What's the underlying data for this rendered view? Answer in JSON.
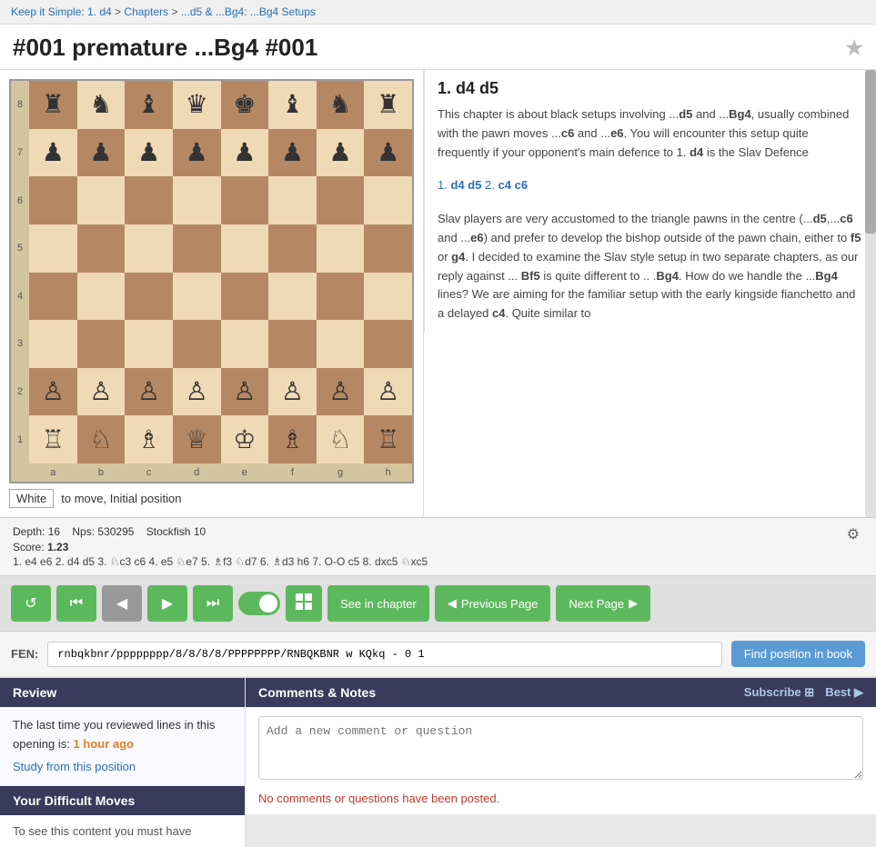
{
  "breadcrumb": {
    "items": [
      {
        "label": "Keep it Simple: 1. d4",
        "href": "#"
      },
      {
        "label": "Chapters",
        "href": "#"
      },
      {
        "label": "...d5 & ...Bg4: ...Bg4 Setups",
        "href": "#"
      }
    ],
    "separator": " > "
  },
  "page": {
    "title": "#001 premature ...Bg4 #001"
  },
  "board": {
    "status_side": "White",
    "status_text": "to move, Initial position",
    "fen_value": "rnbqkbnr/pppppppp/8/8/8/8/PPPPPPPP/RNBQKBNR w KQkq - 0 1",
    "fen_label": "FEN:"
  },
  "text_panel": {
    "move_header": "1. d4  d5",
    "paragraphs": [
      "This chapter is about black setups involving ...d5 and ...Bg4, usually combined with the pawn moves ...c6 and ...e6. You will encounter this setup quite frequently if your opponent's main defence to 1. d4 is the Slav Defence",
      "1. d4 d5 2. c4 c6",
      "Slav players are very accustomed to the triangle pawns in the centre (...d5,...c6 and ...e6) and prefer to develop the bishop outside of the pawn chain, either to f5 or g4. I decided to examine the Slav style setup in two separate chapters, as our reply against ... Bf5 is quite different to .. .Bg4. How do we handle the ...Bg4 lines? We are aiming for the familiar setup with the early kingside fianchetto and a delayed c4. Quite similar to"
    ],
    "move_links": [
      "1. d4 d5 2.",
      "c4 c6"
    ]
  },
  "engine": {
    "depth": "Depth: 16",
    "nps": "Nps: 530295",
    "engine_name": "Stockfish 10",
    "score_label": "Score:",
    "score_value": "1.23",
    "moves": "1. e4 e6 2. d4 d5 3. ♘c3 c6 4. e5 ♘e7 5. ♗f3 ♘d7 6. ♗d3 h6 7. O-O c5 8. dxc5 ♘xc5"
  },
  "controls": {
    "restart_icon": "↺",
    "first_icon": "⏮",
    "prev_icon": "◀",
    "next_icon": "▶",
    "last_icon": "⏭",
    "board_icon": "⊞",
    "see_in_chapter": "See in chapter",
    "previous_page": "Previous Page",
    "next_page": "Next Page"
  },
  "fen_section": {
    "find_button": "Find position in book"
  },
  "review": {
    "header": "Review",
    "body": "The last time you reviewed lines in this opening is:",
    "time_highlight": "1 hour ago",
    "study_link": "Study from this position"
  },
  "difficult_moves": {
    "header": "Your Difficult Moves",
    "body": "To see this content you must have"
  },
  "comments": {
    "header": "Comments & Notes",
    "subscribe_label": "Subscribe",
    "rss_icon": "⊞",
    "best_label": "Best",
    "placeholder": "Add a new comment or question",
    "no_comments": "No comments or questions have been posted."
  }
}
